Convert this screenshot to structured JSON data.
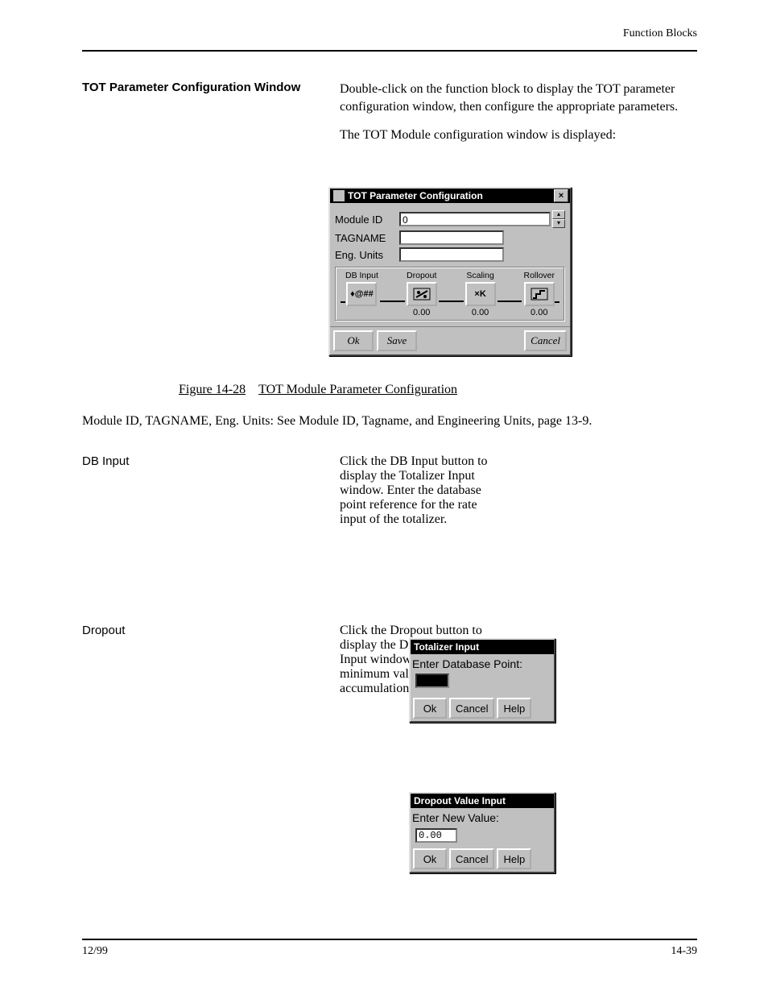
{
  "header_right": "Function Blocks",
  "footer_left": "12/99",
  "footer_right": "14-39",
  "intro_left": "TOT Parameter Configuration Window",
  "intro_right_1": "Double-click on the function block to display the TOT parameter configuration window, then configure the appropriate parameters.",
  "intro_right_2": "The TOT Module configuration window is displayed:",
  "caption_prefix": "Figure 14-28",
  "caption_text": "TOT Module Parameter Configuration",
  "line_module_id": "Module ID, TAGNAME, Eng. Units:  See Module ID, Tagname, and Engineering Units, page 13-9.",
  "db_input_label": "DB Input",
  "db_input_text": "Click the DB Input button to display the Totalizer Input window.  Enter the database point reference for the rate input of the totalizer.",
  "dropout_label": "Dropout",
  "dropout_text": "Click the Dropout button to display the Dropout Value Input window.  Enter the minimum value at which accumulation takes place.",
  "dlg_main": {
    "title": "TOT Parameter Configuration",
    "fields": {
      "module_id_label": "Module ID",
      "module_id_value": "0",
      "tagname_label": "TAGNAME",
      "tagname_value": "",
      "eng_units_label": "Eng. Units",
      "eng_units_value": ""
    },
    "stages": {
      "dbinput": "DB Input",
      "dropout": "Dropout",
      "scaling": "Scaling",
      "rollover": "Rollover",
      "dbinput_icon": "♦@##",
      "scaling_icon": "×K",
      "val_zero": "0.00"
    },
    "buttons": {
      "ok": "Ok",
      "save": "Save",
      "cancel": "Cancel"
    }
  },
  "dlg_totalizer": {
    "title": "Totalizer Input",
    "prompt": "Enter Database Point:",
    "value": "",
    "buttons": {
      "ok": "Ok",
      "cancel": "Cancel",
      "help": "Help"
    }
  },
  "dlg_dropout": {
    "title": "Dropout Value Input",
    "prompt": "Enter New Value:",
    "value": "0.00",
    "buttons": {
      "ok": "Ok",
      "cancel": "Cancel",
      "help": "Help"
    }
  }
}
